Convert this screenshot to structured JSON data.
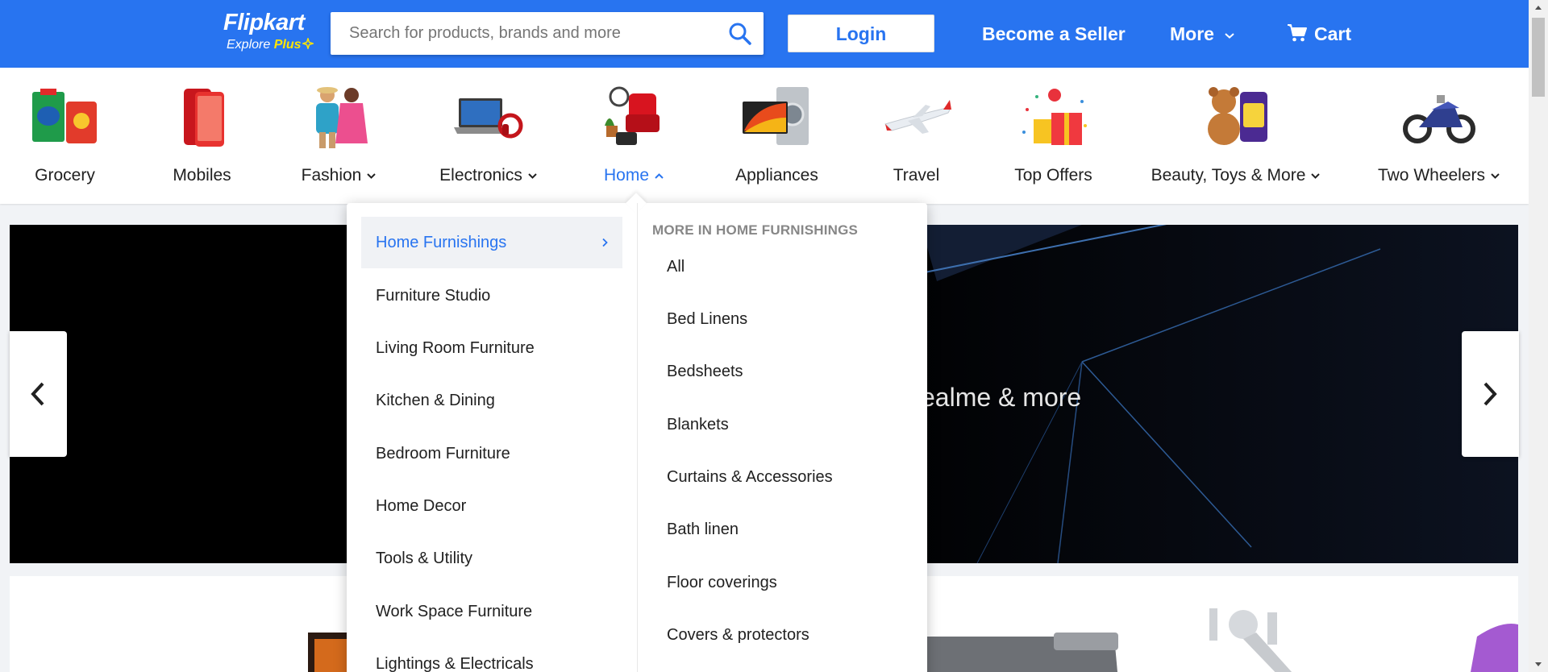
{
  "header": {
    "logo_text": "Flipkart",
    "logo_sub_text": "Explore",
    "logo_sub_plus": "Plus",
    "search_placeholder": "Search for products, brands and more",
    "login_label": "Login",
    "seller_label": "Become a Seller",
    "more_label": "More",
    "cart_label": "Cart",
    "brand_color": "#2874f0"
  },
  "categories": [
    {
      "label": "Grocery",
      "icon": "grocery-icon"
    },
    {
      "label": "Mobiles",
      "icon": "mobile-phone-icon"
    },
    {
      "label": "Fashion",
      "icon": "fashion-icon",
      "has_dropdown": true
    },
    {
      "label": "Electronics",
      "icon": "laptop-icon",
      "has_dropdown": true
    },
    {
      "label": "Home",
      "icon": "home-furniture-icon",
      "has_dropdown": true,
      "active": true
    },
    {
      "label": "Appliances",
      "icon": "appliances-icon"
    },
    {
      "label": "Travel",
      "icon": "airplane-icon"
    },
    {
      "label": "Top Offers",
      "icon": "gift-offer-icon"
    },
    {
      "label": "Beauty, Toys & More",
      "icon": "teddy-bear-icon",
      "has_dropdown": true
    },
    {
      "label": "Two Wheelers",
      "icon": "motorcycle-icon",
      "has_dropdown": true
    }
  ],
  "banner": {
    "text": "ealme & more"
  },
  "dropdown": {
    "left_items": [
      "Home Furnishings",
      "Furniture Studio",
      "Living Room Furniture",
      "Kitchen & Dining",
      "Bedroom Furniture",
      "Home Decor",
      "Tools & Utility",
      "Work Space Furniture",
      "Lightings & Electricals"
    ],
    "active_item": "Home Furnishings",
    "right_heading": "MORE IN HOME FURNISHINGS",
    "right_items": [
      "All",
      "Bed Linens",
      "Bedsheets",
      "Blankets",
      "Curtains & Accessories",
      "Bath linen",
      "Floor coverings",
      "Covers & protectors"
    ]
  }
}
